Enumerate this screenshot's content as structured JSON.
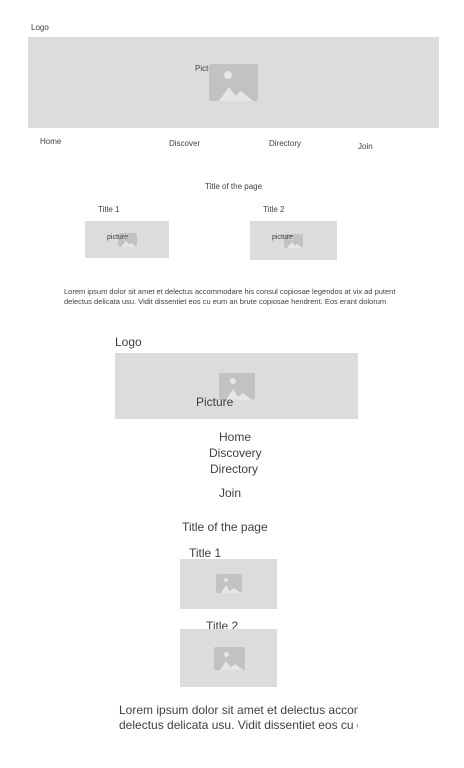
{
  "desktop": {
    "logo": "Logo",
    "hero_label": "Picture",
    "nav": [
      "Home",
      "Discover",
      "Directory",
      "Join"
    ],
    "page_title": "Title of the page",
    "cards": [
      {
        "title": "Title 1",
        "image_label": "picture"
      },
      {
        "title": "Title 2",
        "image_label": "picture"
      }
    ],
    "body_lines": [
      "Lorem ipsum dolor sit amet et delectus accommodare his consul copiosae legendos at vix ad putent",
      "delectus delicata usu. Vidit dissentiet eos cu eum an brute copiosae hendrerit. Eos erant dolorum"
    ]
  },
  "mobile": {
    "logo": "Logo",
    "hero_label": "Picture",
    "nav": [
      "Home",
      "Discovery",
      "Directory",
      "Join"
    ],
    "page_title": "Title of the page",
    "cards": [
      {
        "title": "Title 1"
      },
      {
        "title": "Title 2"
      }
    ],
    "body_lines": [
      "Lorem ipsum dolor sit amet et delectus accommodare his consul copiosae legendos",
      "delectus delicata usu. Vidit dissentiet eos cu eum an brute copiosae hendrerit."
    ]
  }
}
